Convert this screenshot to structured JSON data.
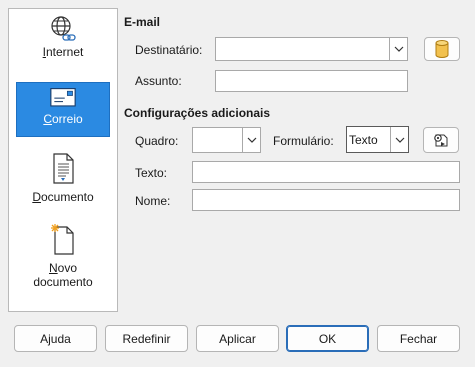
{
  "sidebar": {
    "items": [
      {
        "label_pre": "",
        "label_u": "I",
        "label_post": "nternet",
        "icon": "globe-link-icon"
      },
      {
        "label_pre": "",
        "label_u": "C",
        "label_post": "orreio",
        "icon": "mail-icon"
      },
      {
        "label_pre": "",
        "label_u": "D",
        "label_post": "ocumento",
        "icon": "document-icon"
      },
      {
        "label_pre": "",
        "label_u": "N",
        "label_post": "ovo",
        "label_line2": "documento",
        "icon": "new-document-icon"
      }
    ]
  },
  "email": {
    "title": "E-mail",
    "recipient_label": "Destinatário:",
    "recipient_value": "",
    "subject_label": "Assunto:",
    "subject_value": ""
  },
  "additional": {
    "title": "Configurações adicionais",
    "frame_label": "Quadro:",
    "frame_value": "",
    "form_label": "Formulário:",
    "form_value": "Texto",
    "text_label": "Texto:",
    "text_value": "",
    "name_label": "Nome:",
    "name_value": ""
  },
  "buttons": {
    "help": "Ajuda",
    "reset": "Redefinir",
    "apply": "Aplicar",
    "ok": "OK",
    "close": "Fechar"
  },
  "colors": {
    "selection": "#2b8ae2",
    "database_icon": "#f2c14e"
  }
}
